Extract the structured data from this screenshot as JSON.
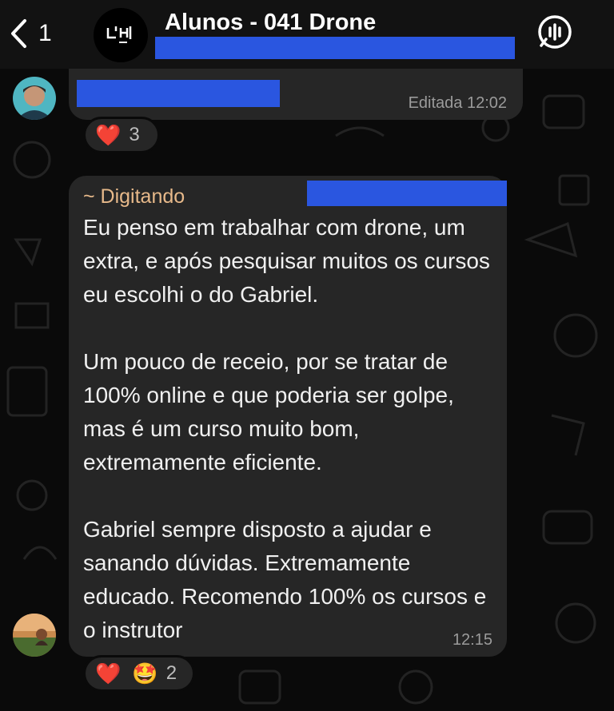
{
  "header": {
    "back_count": "1",
    "group_title": "Alunos - 041 Drone",
    "avatar_logo": "CH"
  },
  "messages": [
    {
      "edited_time": "Editada 12:02",
      "reactions": [
        {
          "emoji": "❤️"
        }
      ],
      "reaction_count": "3"
    },
    {
      "sender": "~ Digitando",
      "text": "Eu penso em trabalhar com drone, um extra, e após pesquisar muitos os cursos eu escolhi o do Gabriel.\n\nUm pouco de receio, por se tratar de 100% online e que poderia ser golpe, mas é um curso muito bom, extremamente eficiente.\n\nGabriel sempre disposto a ajudar e sanando dúvidas. Extremamente educado. Recomendo 100% os cursos e o instrutor",
      "time": "12:15",
      "reactions": [
        {
          "emoji": "❤️"
        },
        {
          "emoji": "🤩"
        }
      ],
      "reaction_count": "2"
    }
  ],
  "colors": {
    "redaction": "#2a56e0",
    "bubble": "#262626",
    "sender_name": "#e7b98a"
  }
}
